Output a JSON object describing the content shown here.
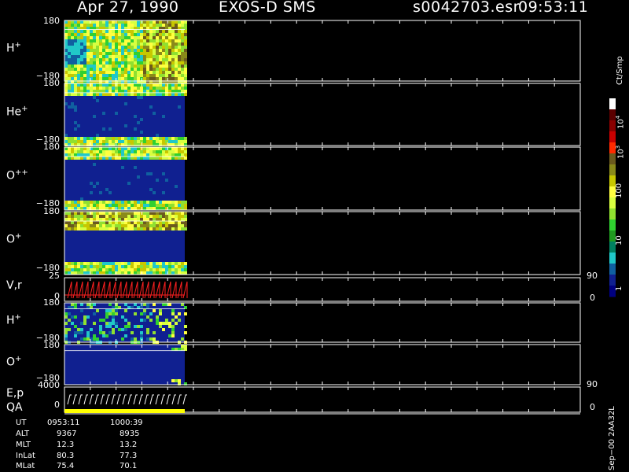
{
  "header": {
    "date": "Apr 27, 1990",
    "instrument": "EXOS-D SMS",
    "file": "s0042703.esr",
    "time": "09:53:11"
  },
  "colorbar": {
    "unit": "Ct/Smp",
    "ticks": [
      "10^4",
      "10^3",
      "100",
      "10",
      "1"
    ],
    "colors": [
      "#ffffff",
      "#5a0000",
      "#8a0000",
      "#c80000",
      "#ff2a00",
      "#6b5a1e",
      "#8a8a1a",
      "#c8c800",
      "#ffff40",
      "#d8ff40",
      "#90e030",
      "#30d030",
      "#209a20",
      "#008060",
      "#20c8c8",
      "#1060a0",
      "#102090",
      "#000080"
    ]
  },
  "panels": [
    {
      "label": "H+",
      "top_tick": "180",
      "bottom_tick": "−180"
    },
    {
      "label": "He+",
      "top_tick": "180",
      "bottom_tick": "−180"
    },
    {
      "label": "O++",
      "top_tick": "180",
      "bottom_tick": "−180"
    },
    {
      "label": "O+",
      "top_tick": "180",
      "bottom_tick": "−180"
    },
    {
      "label": "V,r",
      "top_tick": "25",
      "bottom_tick": "0",
      "right_top": "90",
      "right_bottom": "0"
    },
    {
      "label": "H+",
      "top_tick": "180",
      "bottom_tick": "−180"
    },
    {
      "label": "O+",
      "top_tick": "180",
      "bottom_tick": "−180"
    },
    {
      "label": "E,p",
      "top_tick": "4000",
      "bottom_tick": "0",
      "right_top": "90",
      "right_bottom": "0"
    },
    {
      "label": "QA"
    }
  ],
  "orbit_table": {
    "rows": [
      {
        "name": "UT",
        "v1": "0953:11",
        "v2": "1000:39"
      },
      {
        "name": "ALT",
        "v1": "9367",
        "v2": "8935"
      },
      {
        "name": "MLT",
        "v1": "12.3",
        "v2": "13.2"
      },
      {
        "name": "InLat",
        "v1": "80.3",
        "v2": "77.3"
      },
      {
        "name": "MLat",
        "v1": "75.4",
        "v2": "70.1"
      }
    ]
  },
  "footer_vertical": "Sep−00 2AA32L",
  "chart_data": {
    "type": "heatmap",
    "x_tick_count": 21,
    "colors": {
      "background": "#000000",
      "axis": "#ffffff",
      "low_flux": "#102090",
      "velocity_trace": "#ff2020",
      "energy_trace": "#ffffff",
      "qa_flag": "#ffff00"
    }
  }
}
